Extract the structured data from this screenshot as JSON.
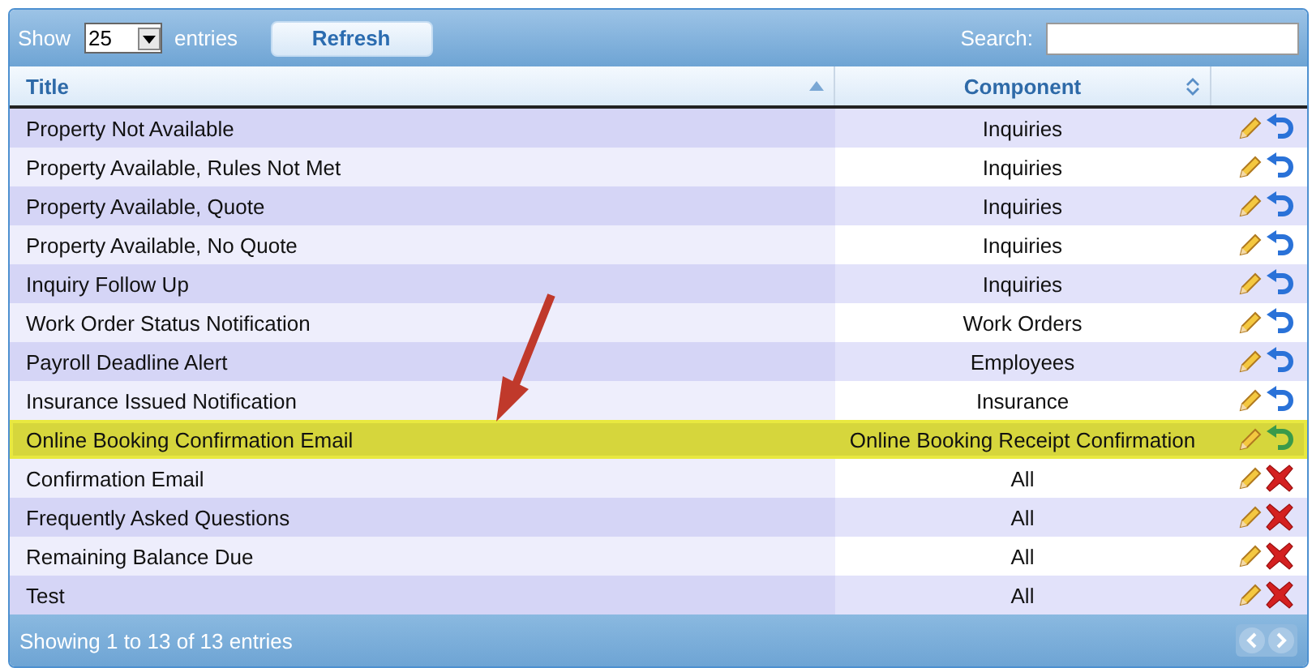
{
  "toolbar": {
    "show_label": "Show",
    "page_size": "25",
    "entries_label": "entries",
    "refresh_button": "Refresh",
    "search_label": "Search:"
  },
  "table": {
    "columns": [
      {
        "label": "Title",
        "sorted": true
      },
      {
        "label": "Component",
        "sorted": false
      }
    ],
    "rows": [
      {
        "title": "Property Not Available",
        "component": "Inquiries",
        "kind": "revert",
        "selected": false
      },
      {
        "title": "Property Available, Rules Not Met",
        "component": "Inquiries",
        "kind": "revert",
        "selected": false
      },
      {
        "title": "Property Available, Quote",
        "component": "Inquiries",
        "kind": "revert",
        "selected": false
      },
      {
        "title": "Property Available, No Quote",
        "component": "Inquiries",
        "kind": "revert",
        "selected": false
      },
      {
        "title": "Inquiry Follow Up",
        "component": "Inquiries",
        "kind": "revert",
        "selected": false
      },
      {
        "title": "Work Order Status Notification",
        "component": "Work Orders",
        "kind": "revert",
        "selected": false
      },
      {
        "title": "Payroll Deadline Alert",
        "component": "Employees",
        "kind": "revert",
        "selected": false
      },
      {
        "title": "Insurance Issued Notification",
        "component": "Insurance",
        "kind": "revert",
        "selected": false
      },
      {
        "title": "Online Booking Confirmation Email",
        "component": "Online Booking Receipt Confirmation",
        "kind": "revert",
        "selected": true
      },
      {
        "title": "Confirmation Email",
        "component": "All",
        "kind": "delete",
        "selected": false
      },
      {
        "title": "Frequently Asked Questions",
        "component": "All",
        "kind": "delete",
        "selected": false
      },
      {
        "title": "Remaining Balance Due",
        "component": "All",
        "kind": "delete",
        "selected": false
      },
      {
        "title": "Test",
        "component": "All",
        "kind": "delete",
        "selected": false
      }
    ]
  },
  "footer": {
    "info": "Showing 1 to 13 of 13 entries"
  }
}
